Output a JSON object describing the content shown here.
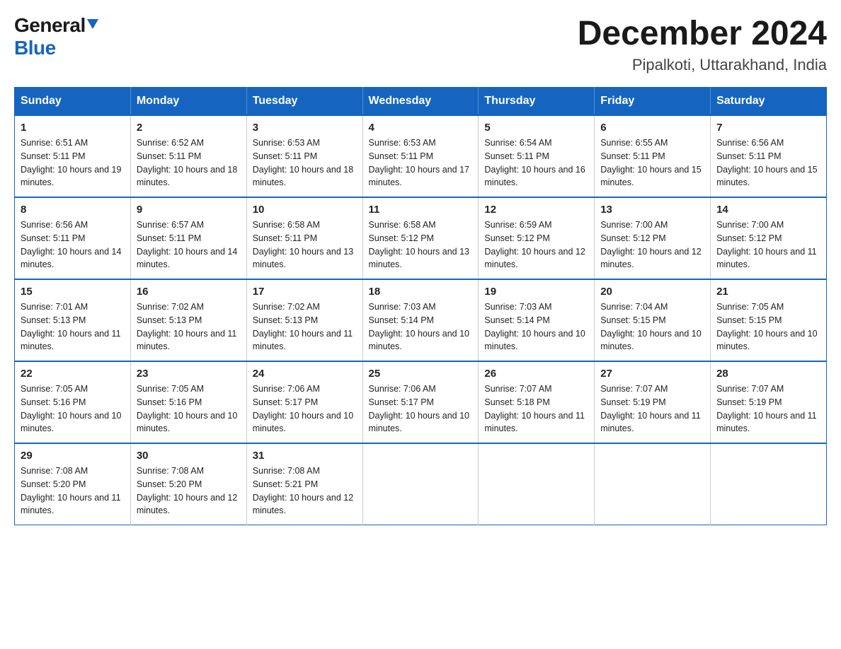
{
  "logo": {
    "general": "General",
    "blue": "Blue"
  },
  "title": {
    "month": "December 2024",
    "location": "Pipalkoti, Uttarakhand, India"
  },
  "weekdays": [
    "Sunday",
    "Monday",
    "Tuesday",
    "Wednesday",
    "Thursday",
    "Friday",
    "Saturday"
  ],
  "weeks": [
    [
      {
        "day": "1",
        "sunrise": "6:51 AM",
        "sunset": "5:11 PM",
        "daylight": "10 hours and 19 minutes."
      },
      {
        "day": "2",
        "sunrise": "6:52 AM",
        "sunset": "5:11 PM",
        "daylight": "10 hours and 18 minutes."
      },
      {
        "day": "3",
        "sunrise": "6:53 AM",
        "sunset": "5:11 PM",
        "daylight": "10 hours and 18 minutes."
      },
      {
        "day": "4",
        "sunrise": "6:53 AM",
        "sunset": "5:11 PM",
        "daylight": "10 hours and 17 minutes."
      },
      {
        "day": "5",
        "sunrise": "6:54 AM",
        "sunset": "5:11 PM",
        "daylight": "10 hours and 16 minutes."
      },
      {
        "day": "6",
        "sunrise": "6:55 AM",
        "sunset": "5:11 PM",
        "daylight": "10 hours and 15 minutes."
      },
      {
        "day": "7",
        "sunrise": "6:56 AM",
        "sunset": "5:11 PM",
        "daylight": "10 hours and 15 minutes."
      }
    ],
    [
      {
        "day": "8",
        "sunrise": "6:56 AM",
        "sunset": "5:11 PM",
        "daylight": "10 hours and 14 minutes."
      },
      {
        "day": "9",
        "sunrise": "6:57 AM",
        "sunset": "5:11 PM",
        "daylight": "10 hours and 14 minutes."
      },
      {
        "day": "10",
        "sunrise": "6:58 AM",
        "sunset": "5:11 PM",
        "daylight": "10 hours and 13 minutes."
      },
      {
        "day": "11",
        "sunrise": "6:58 AM",
        "sunset": "5:12 PM",
        "daylight": "10 hours and 13 minutes."
      },
      {
        "day": "12",
        "sunrise": "6:59 AM",
        "sunset": "5:12 PM",
        "daylight": "10 hours and 12 minutes."
      },
      {
        "day": "13",
        "sunrise": "7:00 AM",
        "sunset": "5:12 PM",
        "daylight": "10 hours and 12 minutes."
      },
      {
        "day": "14",
        "sunrise": "7:00 AM",
        "sunset": "5:12 PM",
        "daylight": "10 hours and 11 minutes."
      }
    ],
    [
      {
        "day": "15",
        "sunrise": "7:01 AM",
        "sunset": "5:13 PM",
        "daylight": "10 hours and 11 minutes."
      },
      {
        "day": "16",
        "sunrise": "7:02 AM",
        "sunset": "5:13 PM",
        "daylight": "10 hours and 11 minutes."
      },
      {
        "day": "17",
        "sunrise": "7:02 AM",
        "sunset": "5:13 PM",
        "daylight": "10 hours and 11 minutes."
      },
      {
        "day": "18",
        "sunrise": "7:03 AM",
        "sunset": "5:14 PM",
        "daylight": "10 hours and 10 minutes."
      },
      {
        "day": "19",
        "sunrise": "7:03 AM",
        "sunset": "5:14 PM",
        "daylight": "10 hours and 10 minutes."
      },
      {
        "day": "20",
        "sunrise": "7:04 AM",
        "sunset": "5:15 PM",
        "daylight": "10 hours and 10 minutes."
      },
      {
        "day": "21",
        "sunrise": "7:05 AM",
        "sunset": "5:15 PM",
        "daylight": "10 hours and 10 minutes."
      }
    ],
    [
      {
        "day": "22",
        "sunrise": "7:05 AM",
        "sunset": "5:16 PM",
        "daylight": "10 hours and 10 minutes."
      },
      {
        "day": "23",
        "sunrise": "7:05 AM",
        "sunset": "5:16 PM",
        "daylight": "10 hours and 10 minutes."
      },
      {
        "day": "24",
        "sunrise": "7:06 AM",
        "sunset": "5:17 PM",
        "daylight": "10 hours and 10 minutes."
      },
      {
        "day": "25",
        "sunrise": "7:06 AM",
        "sunset": "5:17 PM",
        "daylight": "10 hours and 10 minutes."
      },
      {
        "day": "26",
        "sunrise": "7:07 AM",
        "sunset": "5:18 PM",
        "daylight": "10 hours and 11 minutes."
      },
      {
        "day": "27",
        "sunrise": "7:07 AM",
        "sunset": "5:19 PM",
        "daylight": "10 hours and 11 minutes."
      },
      {
        "day": "28",
        "sunrise": "7:07 AM",
        "sunset": "5:19 PM",
        "daylight": "10 hours and 11 minutes."
      }
    ],
    [
      {
        "day": "29",
        "sunrise": "7:08 AM",
        "sunset": "5:20 PM",
        "daylight": "10 hours and 11 minutes."
      },
      {
        "day": "30",
        "sunrise": "7:08 AM",
        "sunset": "5:20 PM",
        "daylight": "10 hours and 12 minutes."
      },
      {
        "day": "31",
        "sunrise": "7:08 AM",
        "sunset": "5:21 PM",
        "daylight": "10 hours and 12 minutes."
      },
      null,
      null,
      null,
      null
    ]
  ]
}
